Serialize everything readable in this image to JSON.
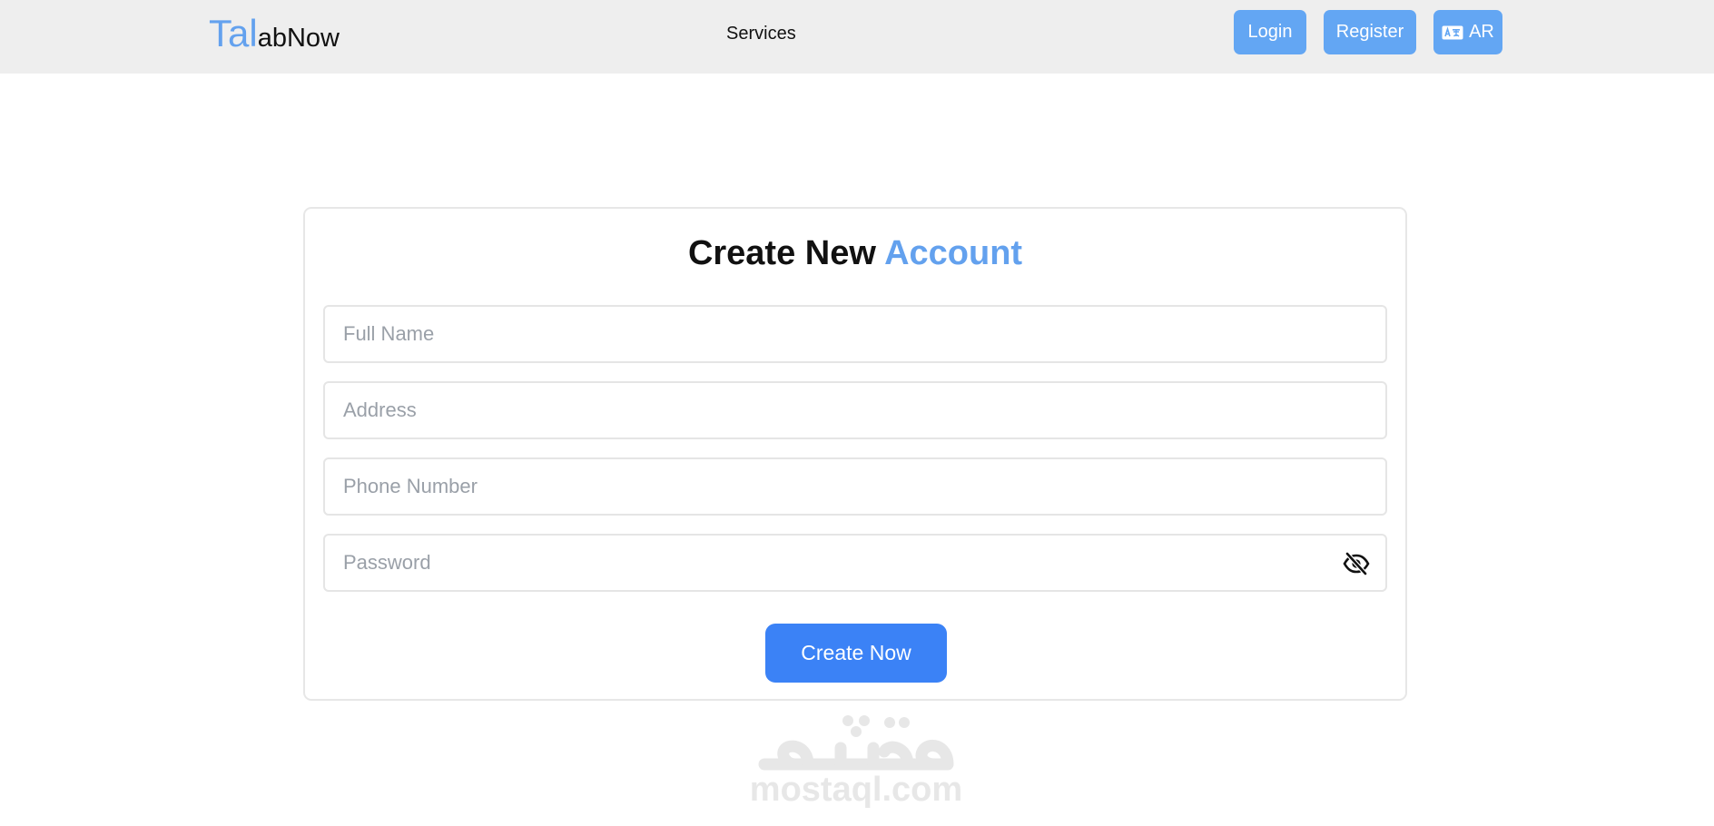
{
  "navbar": {
    "logo": {
      "accent": "Tal",
      "rest": "abNow"
    },
    "services_label": "Services",
    "login_label": "Login",
    "register_label": "Register",
    "language_label": "AR",
    "language_icon": "language-icon"
  },
  "form": {
    "title_main": "Create New ",
    "title_accent": "Account",
    "full_name_placeholder": "Full Name",
    "address_placeholder": "Address",
    "phone_placeholder": "Phone Number",
    "password_placeholder": "Password",
    "password_toggle_icon": "eye-slash-icon",
    "submit_label": "Create Now"
  },
  "watermark": {
    "domain": "mostaql.com"
  },
  "colors": {
    "navbar_bg": "#eeeeee",
    "accent": "#63a1ee",
    "nav_button": "#63a6f3",
    "primary_button": "#3b82f6",
    "input_border": "#e5e5e5"
  }
}
